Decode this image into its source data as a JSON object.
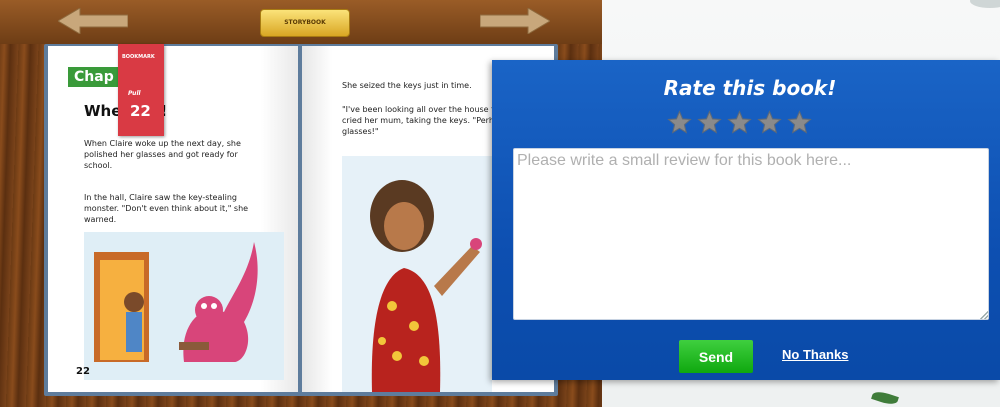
{
  "book": {
    "logo_text": "STORYBOOK",
    "chapter": "Chap",
    "title": "Whe   ight!",
    "left_p1": "When Claire woke up the next day, she polished her glasses and got ready for school.",
    "left_p2": "In the hall, Claire saw the key-stealing monster. \"Don't even think about it,\" she warned.",
    "right_p1": "She seized the keys just in time.",
    "right_p2": "\"I've been looking all over the house for these,\" cried her mum, taking the keys. \"Perhaps I need glasses!\"",
    "page_number": "22",
    "bookmark": {
      "tag": "BOOKMARK",
      "level_label": "Pull",
      "number": "22"
    }
  },
  "dialog": {
    "title": "Rate this book!",
    "stars": [
      {
        "name": "star-1-icon"
      },
      {
        "name": "star-2-icon"
      },
      {
        "name": "star-3-icon"
      },
      {
        "name": "star-4-icon"
      },
      {
        "name": "star-5-icon"
      }
    ],
    "rating": 0,
    "review_placeholder": "Please write a small review for this book here...",
    "send_label": "Send",
    "no_thanks_label": "No Thanks"
  },
  "colors": {
    "dialog_bg": "#1a64c6",
    "send_green": "#2ec02e",
    "star_gray": "#8a8a8a",
    "bookmark_red": "#d93a44",
    "chapter_green": "#3a9a3a"
  },
  "icons": {
    "prev": "arrow-left-icon",
    "next": "arrow-right-icon"
  }
}
